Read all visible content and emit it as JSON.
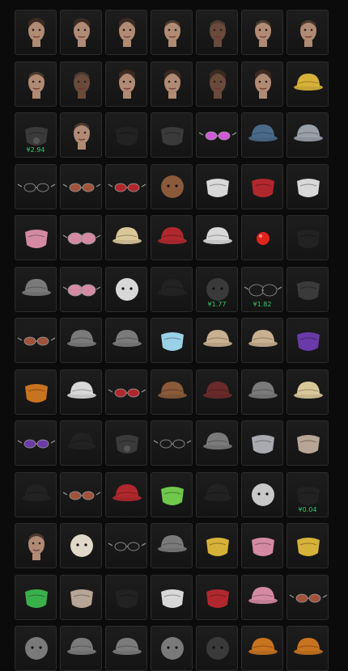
{
  "inventory": {
    "rows": [
      [
        {
          "icon": "face-female-icon"
        },
        {
          "icon": "face-female-icon"
        },
        {
          "icon": "face-female-icon"
        },
        {
          "icon": "face-male-icon"
        },
        {
          "icon": "face-male-dark-icon"
        },
        {
          "icon": "face-male-icon"
        },
        {
          "icon": "face-male-icon"
        }
      ],
      [
        {
          "icon": "face-male-icon"
        },
        {
          "icon": "face-male-dark-icon"
        },
        {
          "icon": "face-female-icon"
        },
        {
          "icon": "face-female-icon"
        },
        {
          "icon": "face-female-dark-icon"
        },
        {
          "icon": "face-female-icon"
        },
        {
          "icon": "crown-hat-icon"
        }
      ],
      [
        {
          "icon": "gas-mask-icon",
          "price": "¥2.94"
        },
        {
          "icon": "face-mask-icon"
        },
        {
          "icon": "bandana-icon"
        },
        {
          "icon": "skull-mask-icon"
        },
        {
          "icon": "heart-glasses-icon"
        },
        {
          "icon": "bucket-hat-icon"
        },
        {
          "icon": "shark-hat-icon"
        }
      ],
      [
        {
          "icon": "sunglasses-icon"
        },
        {
          "icon": "round-glasses-icon"
        },
        {
          "icon": "red-visor-glasses-icon"
        },
        {
          "icon": "bear-head-icon"
        },
        {
          "icon": "animal-mask-icon"
        },
        {
          "icon": "red-mask-icon"
        },
        {
          "icon": "mouse-mask-icon"
        }
      ],
      [
        {
          "icon": "pink-mask-icon"
        },
        {
          "icon": "pink-goggles-icon"
        },
        {
          "icon": "straw-hat-icon"
        },
        {
          "icon": "beret-icon"
        },
        {
          "icon": "captain-hat-icon"
        },
        {
          "icon": "clown-nose-icon"
        },
        {
          "icon": "black-mask-icon"
        }
      ],
      [
        {
          "icon": "baseball-cap-icon"
        },
        {
          "icon": "pink-goggles-icon"
        },
        {
          "icon": "polar-bear-head-icon"
        },
        {
          "icon": "police-cap-icon"
        },
        {
          "icon": "helmet-icon",
          "price": "¥1.77"
        },
        {
          "icon": "goggles-icon",
          "price": "¥1.82"
        },
        {
          "icon": "skull-bandana-icon"
        }
      ],
      [
        {
          "icon": "round-glasses-icon"
        },
        {
          "icon": "fedora-icon"
        },
        {
          "icon": "beanie-icon"
        },
        {
          "icon": "medical-mask-icon"
        },
        {
          "icon": "cow-hat-icon"
        },
        {
          "icon": "cow-hat-icon"
        },
        {
          "icon": "purple-mask-icon"
        }
      ],
      [
        {
          "icon": "orange-mask-icon"
        },
        {
          "icon": "white-cap-icon"
        },
        {
          "icon": "red-sunglasses-icon"
        },
        {
          "icon": "aviator-hat-icon"
        },
        {
          "icon": "top-hat-icon"
        },
        {
          "icon": "flat-cap-icon"
        },
        {
          "icon": "sun-hat-icon"
        }
      ],
      [
        {
          "icon": "purple-glasses-icon"
        },
        {
          "icon": "black-cap-icon"
        },
        {
          "icon": "gas-mask-icon"
        },
        {
          "icon": "steampunk-glasses-icon"
        },
        {
          "icon": "pom-beanie-icon"
        },
        {
          "icon": "husky-mask-icon"
        },
        {
          "icon": "scarf-icon"
        }
      ],
      [
        {
          "icon": "police-cap-icon"
        },
        {
          "icon": "aviator-glasses-icon"
        },
        {
          "icon": "red-cap-icon"
        },
        {
          "icon": "green-balaclava-icon"
        },
        {
          "icon": "officer-cap-icon"
        },
        {
          "icon": "wig-icon"
        },
        {
          "icon": "ninja-mask-icon",
          "price": "¥0.04"
        }
      ],
      [
        {
          "icon": "face-mask-icon"
        },
        {
          "icon": "chicken-head-icon"
        },
        {
          "icon": "sunglasses-icon"
        },
        {
          "icon": "flat-cap-icon"
        },
        {
          "icon": "dog-mask-icon"
        },
        {
          "icon": "pink-animal-mask-icon"
        },
        {
          "icon": "bird-mask-icon"
        }
      ],
      [
        {
          "icon": "dino-mask-icon"
        },
        {
          "icon": "scarf-icon"
        },
        {
          "icon": "hooded-mask-icon"
        },
        {
          "icon": "cat-mask-icon"
        },
        {
          "icon": "red-eye-mask-icon"
        },
        {
          "icon": "pink-beanie-icon"
        },
        {
          "icon": "rimless-glasses-icon"
        }
      ],
      [
        {
          "icon": "cat-ears-icon"
        },
        {
          "icon": "cap-icon"
        },
        {
          "icon": "cap-icon"
        },
        {
          "icon": "hood-icon"
        },
        {
          "icon": "helmet-icon"
        },
        {
          "icon": "spiky-hat-icon"
        },
        {
          "icon": "horn-hat-icon"
        }
      ]
    ]
  }
}
